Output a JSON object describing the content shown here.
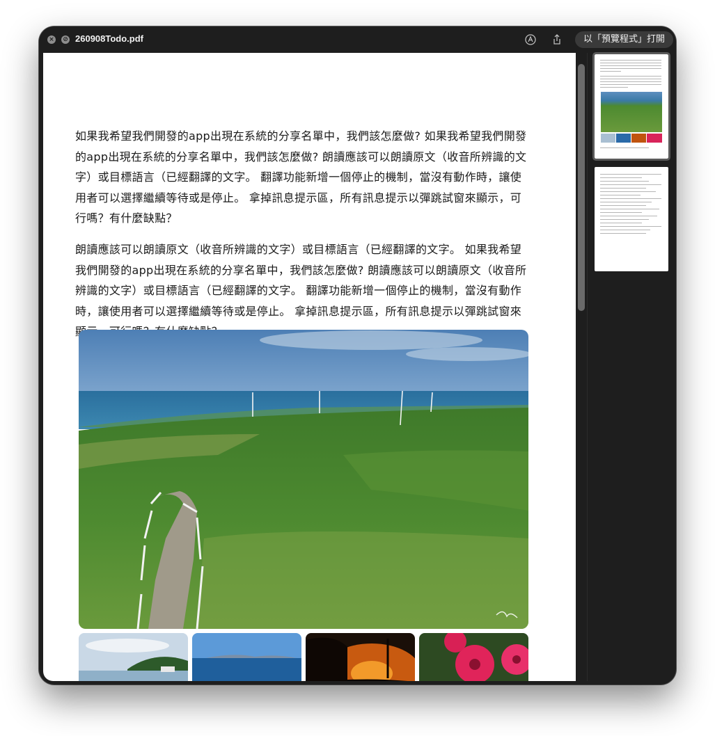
{
  "window": {
    "title": "260908Todo.pdf",
    "open_button_label": "以「預覽程式」打開",
    "icons": [
      "close-icon",
      "disabled-icon",
      "markup-icon",
      "share-icon"
    ]
  },
  "document": {
    "paragraphs": [
      "如果我希望我們開發的app出現在系統的分享名單中，我們該怎麼做? 如果我希望我們開發的app出現在系統的分享名單中，我們該怎麼做? 朗讀應該可以朗讀原文（收音所辨識的文字）或目標語言（已經翻譯的文字。 翻譯功能新增一個停止的機制，當沒有動作時，讓使用者可以選擇繼續等待或是停止。 拿掉訊息提示區，所有訊息提示以彈跳試窗來顯示，可行嗎？有什麼缺點？",
      "朗讀應該可以朗讀原文（收音所辨識的文字）或目標語言（已經翻譯的文字。 如果我希望我們開發的app出現在系統的分享名單中，我們該怎麼做? 朗讀應該可以朗讀原文（收音所辨識的文字）或目標語言（已經翻譯的文字。 翻譯功能新增一個停止的機制，當沒有動作時，讓使用者可以選擇繼續等待或是停止。 拿掉訊息提示區，所有訊息提示以彈跳試窗來顯示，可行嗎？有什麼缺點？"
    ],
    "images": [
      "coastal-grassland-wind-turbines-photo",
      "island-lake-photo",
      "blue-sea-photo",
      "sunset-powerline-photo",
      "red-flowers-photo"
    ]
  },
  "sidebar": {
    "pages": [
      "page-1-thumbnail",
      "page-2-thumbnail"
    ]
  },
  "colors": {
    "window_bg": "#1e1e1e",
    "page_bg": "#ffffff",
    "text": "#1a1a1a"
  }
}
